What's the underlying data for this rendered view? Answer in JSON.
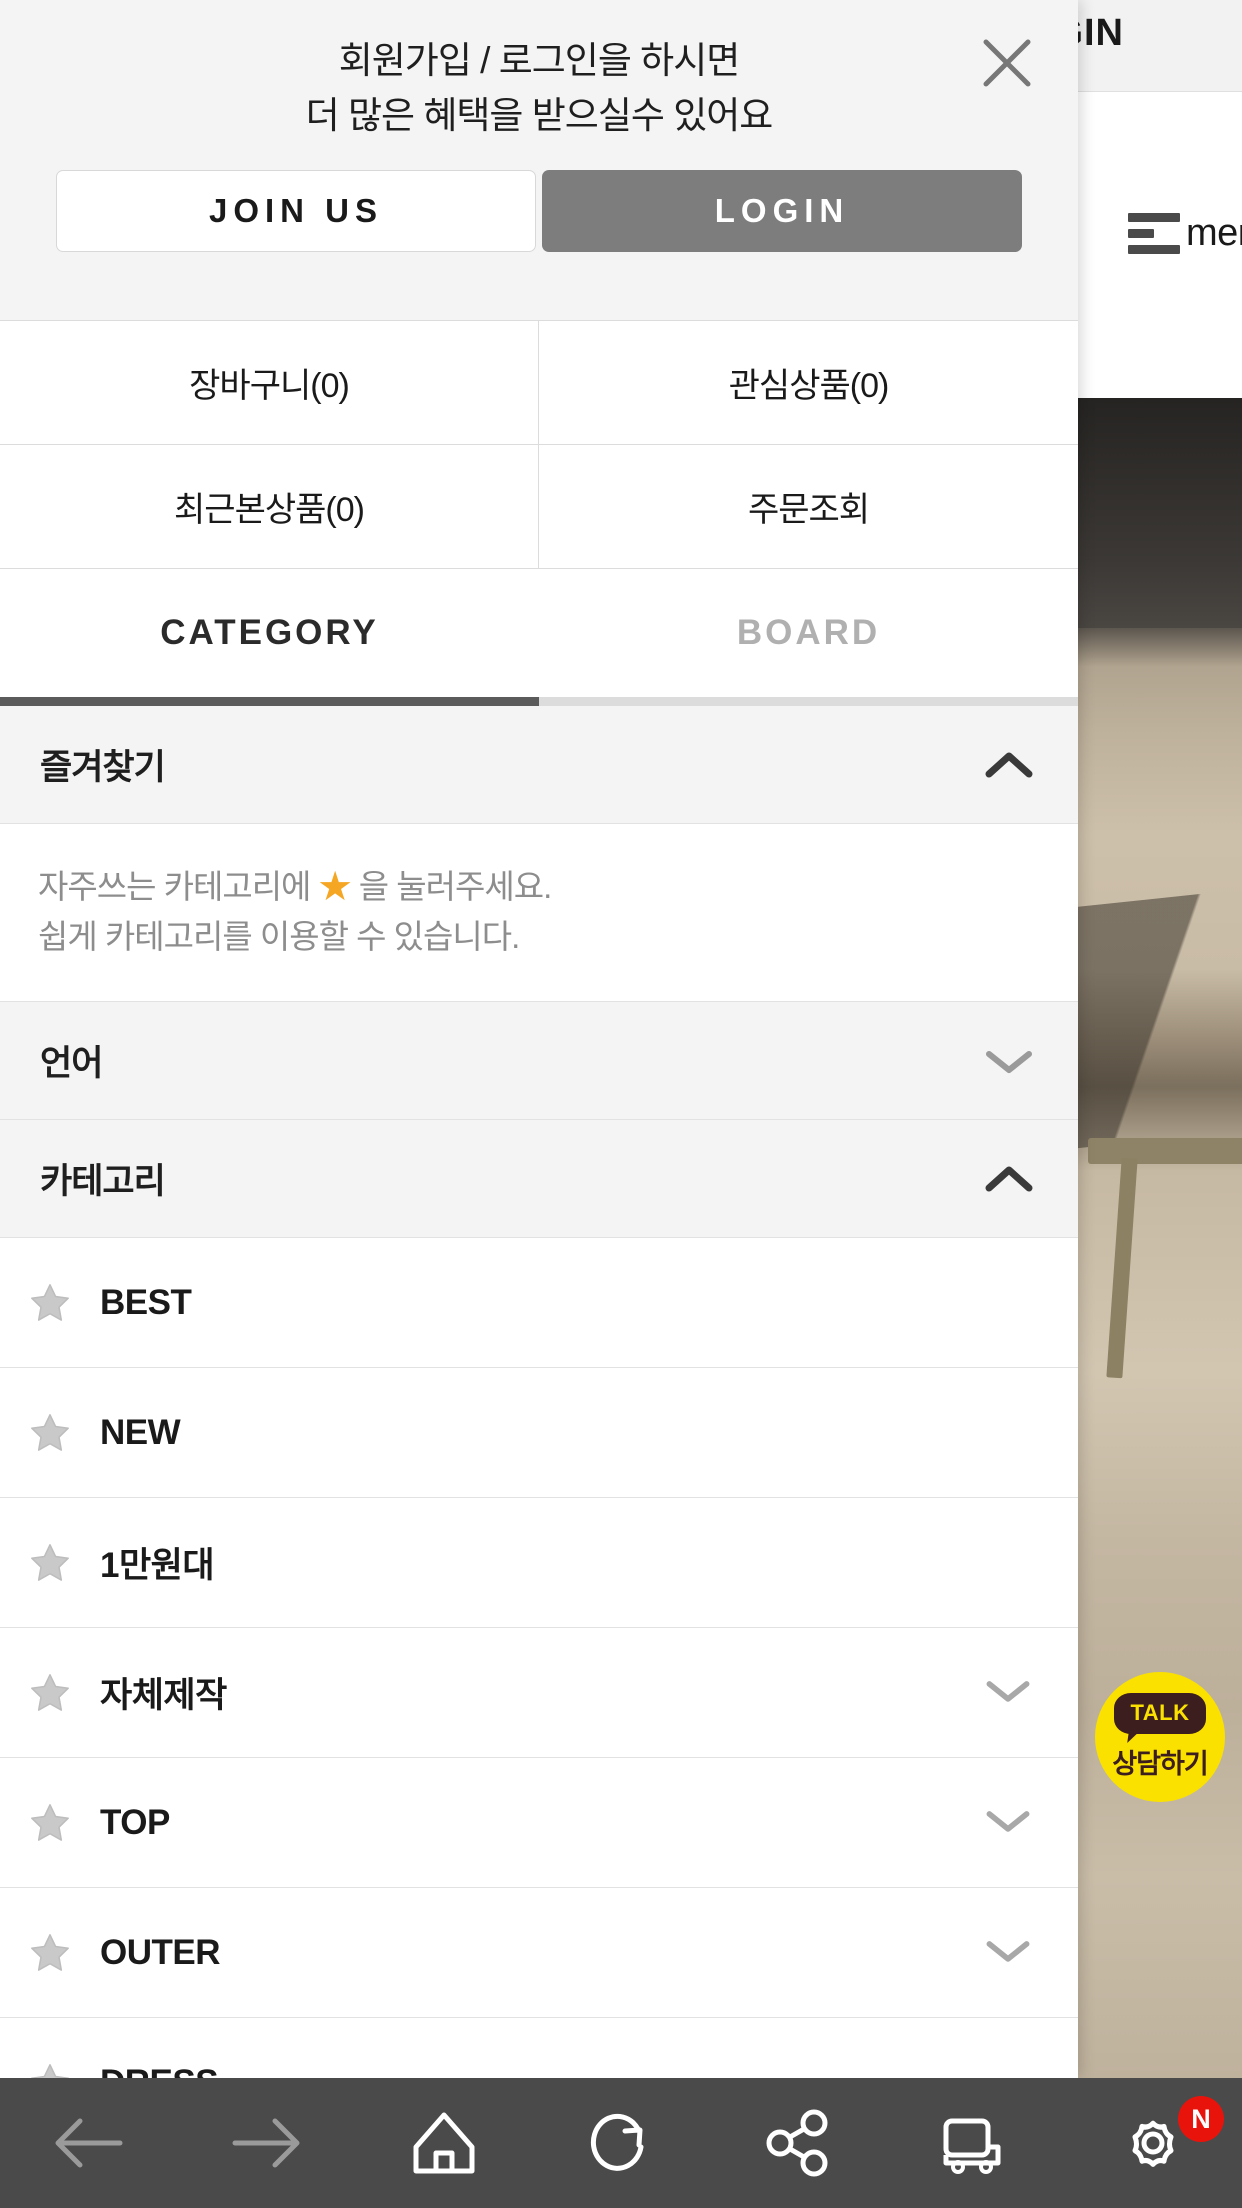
{
  "background": {
    "header_title": "LOGIN",
    "menu_label": "menu"
  },
  "kakao": {
    "bubble_text": "TALK",
    "label": "상담하기",
    "bg_color": "#fae100",
    "text_color": "#3c1e1e"
  },
  "drawer": {
    "promo": {
      "line1": "회원가입 / 로그인을 하시면",
      "line2": "더 많은 혜택을 받으실수 있어요",
      "join_label": "JOIN US",
      "login_label": "LOGIN",
      "login_bg": "#7d7d7d"
    },
    "quick_links": [
      {
        "label": "장바구니(0)"
      },
      {
        "label": "관심상품(0)"
      },
      {
        "label": "최근본상품(0)"
      },
      {
        "label": "주문조회"
      }
    ],
    "tabs": [
      {
        "label": "CATEGORY",
        "active": true
      },
      {
        "label": "BOARD",
        "active": false
      }
    ],
    "sections": [
      {
        "title": "즐겨찾기",
        "state": "expanded",
        "help_line1_before": "자주쓰는 카테고리에 ",
        "help_star": "★",
        "help_line1_after": " 을 눌러주세요.",
        "help_line2": "쉽게 카테고리를 이용할 수 있습니다."
      },
      {
        "title": "언어",
        "state": "collapsed"
      },
      {
        "title": "카테고리",
        "state": "expanded"
      }
    ],
    "categories": [
      {
        "label": "BEST",
        "has_children": false
      },
      {
        "label": "NEW",
        "has_children": false
      },
      {
        "label": "1만원대",
        "has_children": false
      },
      {
        "label": "자체제작",
        "has_children": true
      },
      {
        "label": "TOP",
        "has_children": true
      },
      {
        "label": "OUTER",
        "has_children": true
      },
      {
        "label": "DRESS",
        "has_children": false
      }
    ]
  },
  "bottom_nav": [
    {
      "icon": "back-arrow-icon",
      "disabled": true
    },
    {
      "icon": "forward-arrow-icon",
      "disabled": true
    },
    {
      "icon": "home-icon",
      "disabled": false
    },
    {
      "icon": "refresh-icon",
      "disabled": false
    },
    {
      "icon": "share-icon",
      "disabled": false
    },
    {
      "icon": "delivery-truck-icon",
      "disabled": false
    },
    {
      "icon": "gear-icon",
      "disabled": false,
      "badge": "N",
      "badge_color": "#e8140c"
    }
  ]
}
